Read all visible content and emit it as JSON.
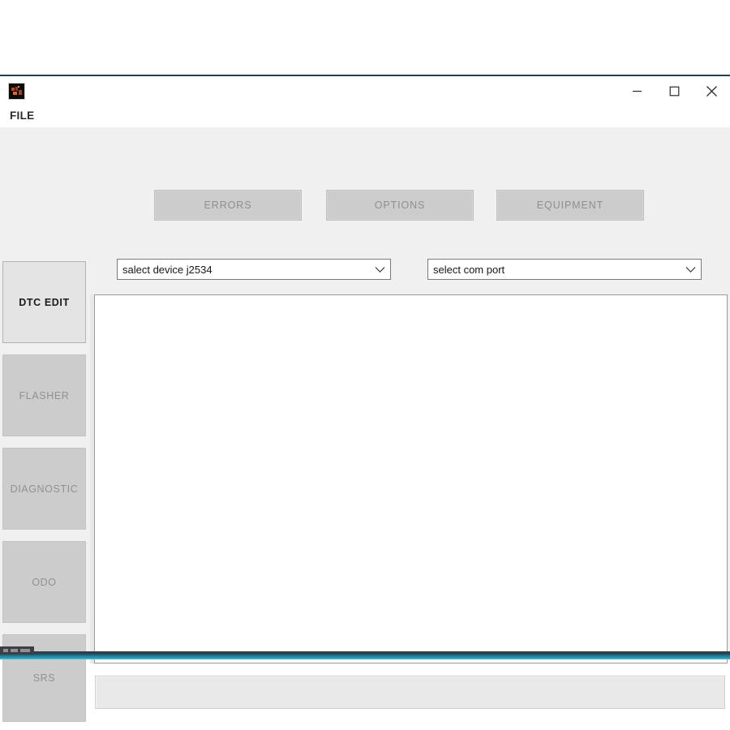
{
  "window": {
    "icon_name": "app-icon",
    "controls": {
      "minimize_label": "Minimize",
      "maximize_label": "Maximize",
      "close_label": "Close"
    }
  },
  "menubar": {
    "items": [
      {
        "label": "FILE"
      }
    ]
  },
  "toolbar": {
    "buttons": [
      {
        "label": "ERRORS",
        "enabled": false
      },
      {
        "label": "OPTIONS",
        "enabled": false
      },
      {
        "label": "EQUIPMENT",
        "enabled": false
      }
    ]
  },
  "selectors": {
    "device": {
      "value": "salect device j2534",
      "arrow_icon": "chevron-down-icon"
    },
    "com_port": {
      "value": "select com port",
      "arrow_icon": "chevron-down-icon"
    }
  },
  "sidebar": {
    "items": [
      {
        "label": "DTC EDIT",
        "active": true
      },
      {
        "label": "FLASHER",
        "active": false
      },
      {
        "label": "DIAGNOSTIC",
        "active": false
      },
      {
        "label": "ODO",
        "active": false
      },
      {
        "label": "SRS",
        "active": false
      }
    ]
  },
  "content": {
    "log_text": ""
  },
  "statusbar": {
    "text": ""
  },
  "colors": {
    "accent_strip": "#2a9ab4",
    "titlebar_border": "#22414d",
    "button_face": "#cccccc",
    "active_tab": "#e4e4e4"
  }
}
